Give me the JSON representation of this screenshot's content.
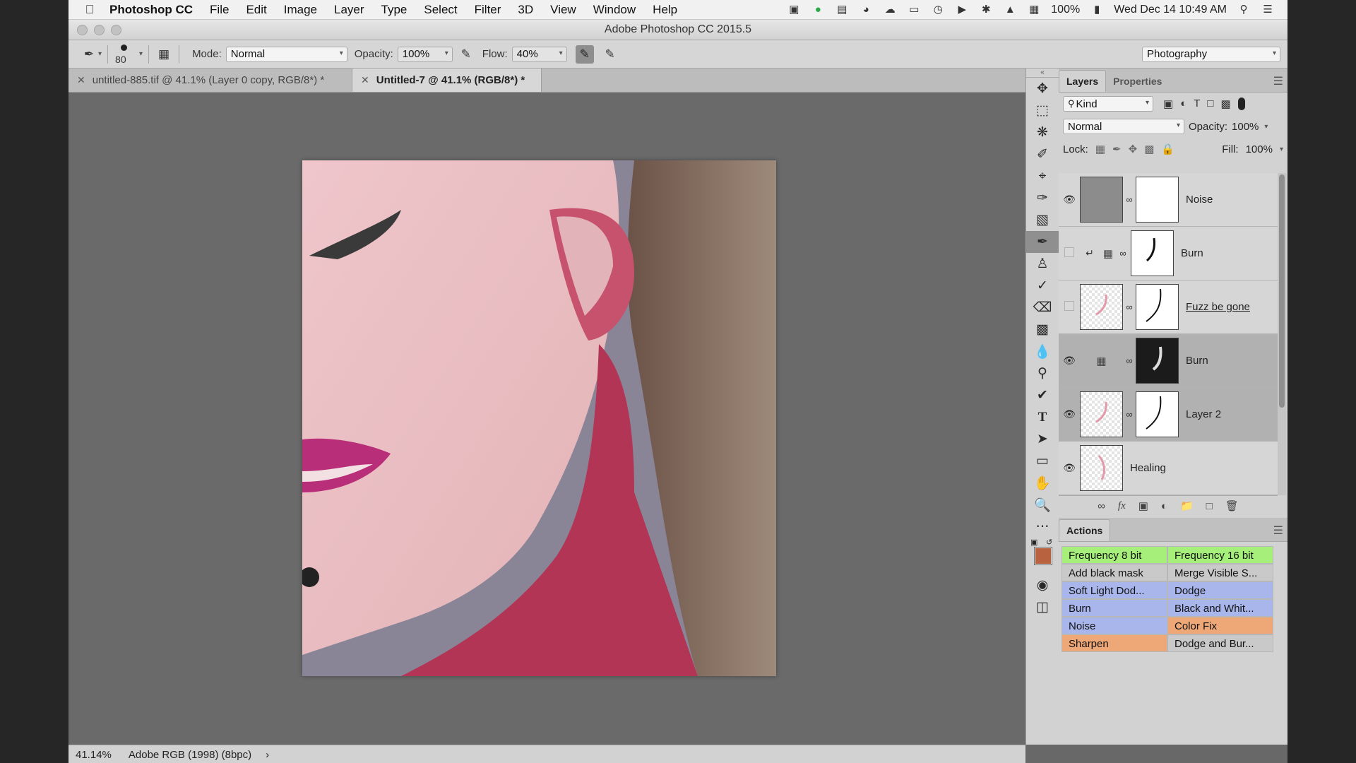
{
  "menubar": {
    "app_name": "Photoshop CC",
    "items": [
      "File",
      "Edit",
      "Image",
      "Layer",
      "Type",
      "Select",
      "Filter",
      "3D",
      "View",
      "Window",
      "Help"
    ],
    "battery": "100%",
    "datetime": "Wed Dec 14  10:49 AM"
  },
  "window": {
    "title": "Adobe Photoshop CC 2015.5"
  },
  "options": {
    "brush_size": "80",
    "mode_label": "Mode:",
    "mode_value": "Normal",
    "opacity_label": "Opacity:",
    "opacity_value": "100%",
    "flow_label": "Flow:",
    "flow_value": "40%",
    "workspace": "Photography"
  },
  "tabs": [
    {
      "label": "untitled-885.tif @ 41.1% (Layer 0 copy, RGB/8*) *",
      "active": false
    },
    {
      "label": "Untitled-7 @ 41.1% (RGB/8*) *",
      "active": true
    }
  ],
  "status": {
    "zoom": "41.14%",
    "profile": "Adobe RGB (1998) (8bpc)"
  },
  "panels": {
    "layers_tab": "Layers",
    "properties_tab": "Properties",
    "filter_kind": "Kind",
    "blend_mode": "Normal",
    "opacity_label": "Opacity:",
    "opacity_value": "100%",
    "lock_label": "Lock:",
    "fill_label": "Fill:",
    "fill_value": "100%"
  },
  "layers": [
    {
      "name": "Noise",
      "visible": true,
      "selected": false
    },
    {
      "name": "Burn",
      "visible": false,
      "selected": false
    },
    {
      "name": "Fuzz be gone",
      "visible": false,
      "selected": false
    },
    {
      "name": "Burn",
      "visible": true,
      "selected": true
    },
    {
      "name": "Layer 2",
      "visible": true,
      "selected": true
    },
    {
      "name": "Healing",
      "visible": true,
      "selected": false
    }
  ],
  "actions": {
    "tab": "Actions",
    "items": [
      {
        "label": "Frequency 8 bit",
        "color": "#a6ef7b"
      },
      {
        "label": "Frequency 16 bit",
        "color": "#a6ef7b"
      },
      {
        "label": "Add black mask",
        "color": "#c9c9c9"
      },
      {
        "label": "Merge Visible S...",
        "color": "#c9c9c9"
      },
      {
        "label": "Soft Light Dod...",
        "color": "#a9b6ec"
      },
      {
        "label": "Dodge",
        "color": "#a9b6ec"
      },
      {
        "label": "Burn",
        "color": "#a9b6ec"
      },
      {
        "label": "Black and Whit...",
        "color": "#a9b6ec"
      },
      {
        "label": "Noise",
        "color": "#a9b6ec"
      },
      {
        "label": "Color Fix",
        "color": "#eea777"
      },
      {
        "label": "Sharpen",
        "color": "#eea777"
      },
      {
        "label": "Dodge and Bur...",
        "color": "#c9c9c9"
      }
    ]
  },
  "colors": {
    "foreground": "#b8623f",
    "background": "#d8855d"
  }
}
